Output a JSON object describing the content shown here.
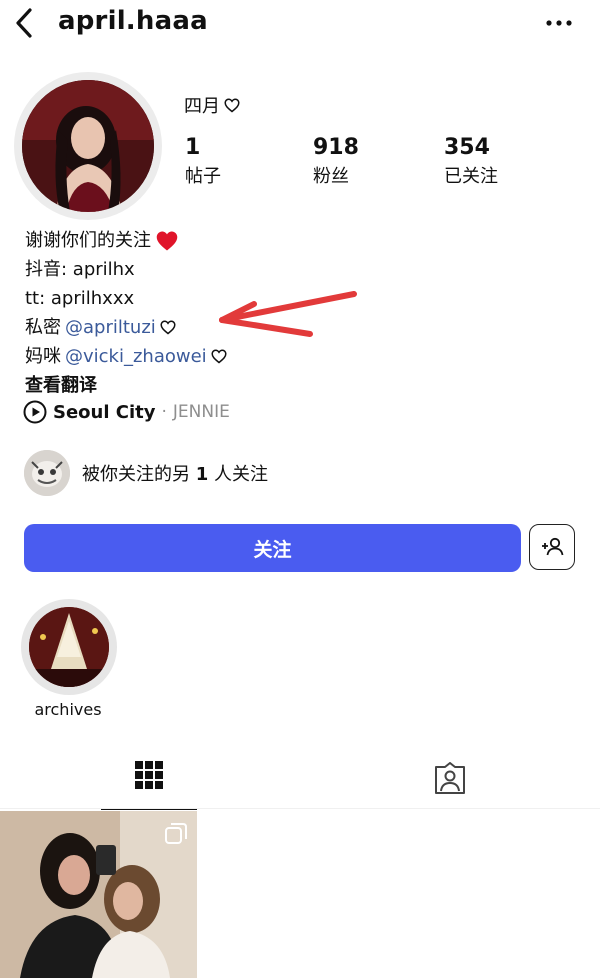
{
  "header": {
    "username": "april.haaa",
    "back_icon": "chevron-left-icon",
    "more_icon": "more-horizontal-icon"
  },
  "profile": {
    "display_name": "四月",
    "stats": [
      {
        "value": "1",
        "label": "帖子"
      },
      {
        "value": "918",
        "label": "粉丝"
      },
      {
        "value": "354",
        "label": "已关注"
      }
    ]
  },
  "bio": {
    "line1": "谢谢你们的关注",
    "line2": "抖音: aprilhx",
    "line3": "tt: aprilhxxx",
    "line4_prefix": "私密",
    "line4_handle": "@apriltuzi",
    "line5_prefix": "妈咪",
    "line5_handle": "@vicki_zhaowei",
    "translate": "查看翻译"
  },
  "music": {
    "song": "Seoul City",
    "separator": "·",
    "artist": "JENNIE"
  },
  "mutual": {
    "prefix": "被你关注的另",
    "count": "1",
    "suffix": "人关注"
  },
  "actions": {
    "follow_label": "关注"
  },
  "highlights": [
    {
      "label": "archives"
    }
  ],
  "tabs": [
    {
      "icon": "grid-icon",
      "active": true
    },
    {
      "icon": "tagged-person-icon",
      "active": false
    }
  ],
  "colors": {
    "follow_button": "#4a5cf0",
    "link": "#3b5a9a",
    "heart_red": "#e0142a",
    "annotation_arrow": "#e23a3a"
  }
}
